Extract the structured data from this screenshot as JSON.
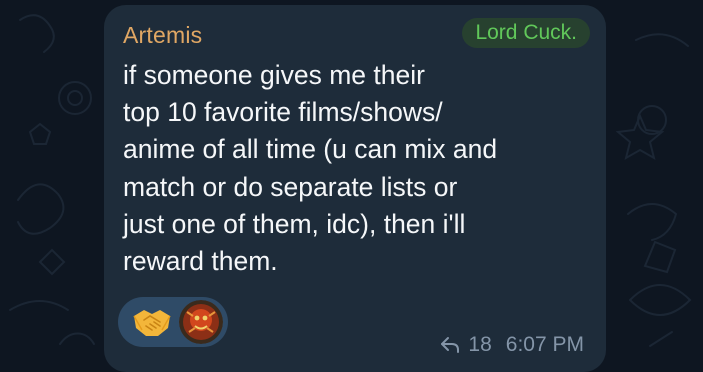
{
  "message": {
    "sender": "Artemis",
    "admin_title": "Lord Cuck.",
    "text": "if someone gives me their\ntop 10 favorite films/shows/\nanime of all time (u can mix and\nmatch or do separate lists or\njust one of them, idc), then i'll\nreward them.",
    "reply_count": "18",
    "time": "6:07 PM"
  },
  "reactions": [
    {
      "emoji": "handshake",
      "reactor_avatar": "user-avatar"
    }
  ],
  "colors": {
    "chat_background": "#0e1621",
    "bubble": "#1e2c3a",
    "sender_name": "#e0a764",
    "admin_badge_text": "#61c85a",
    "admin_badge_bg": "#27412f",
    "message_text": "#f5f7f9",
    "reaction_pill": "#2f4b67",
    "meta_text": "#8495a8"
  },
  "icons": [
    "reply-arrow-icon",
    "handshake-emoji",
    "avatar"
  ]
}
